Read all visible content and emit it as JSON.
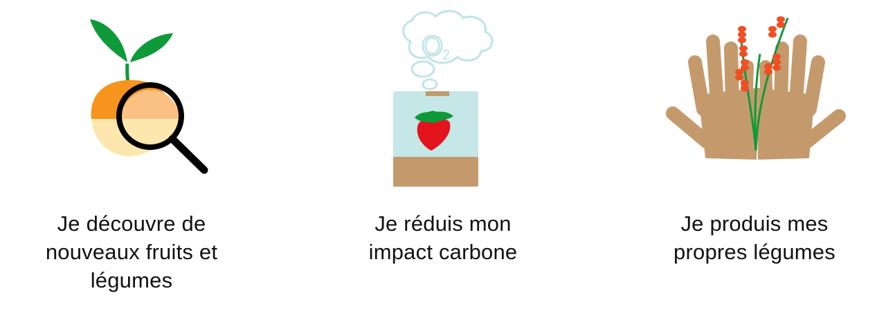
{
  "features": [
    {
      "icon": "vegetable-magnifier-icon",
      "caption": "Je découvre de\nnouveaux fruits et\nlégumes"
    },
    {
      "icon": "strawberry-box-o2-icon",
      "cloud_text": "O",
      "cloud_subscript": "2",
      "caption": "Je réduis mon\nimpact carbone"
    },
    {
      "icon": "hands-plant-icon",
      "caption": "Je produis mes\npropres légumes"
    }
  ],
  "colors": {
    "leaf_green": "#0f9a3a",
    "orange": "#f7941d",
    "light_orange": "#fbc084",
    "pale_yellow": "#fde7ad",
    "cloud_outline": "#bfe4e6",
    "box_blue": "#c5e7e8",
    "soil_brown": "#c49a6c",
    "strawberry_red": "#e3141c",
    "hand_tan": "#c49a6c",
    "berry_orange_red": "#f04e23"
  }
}
